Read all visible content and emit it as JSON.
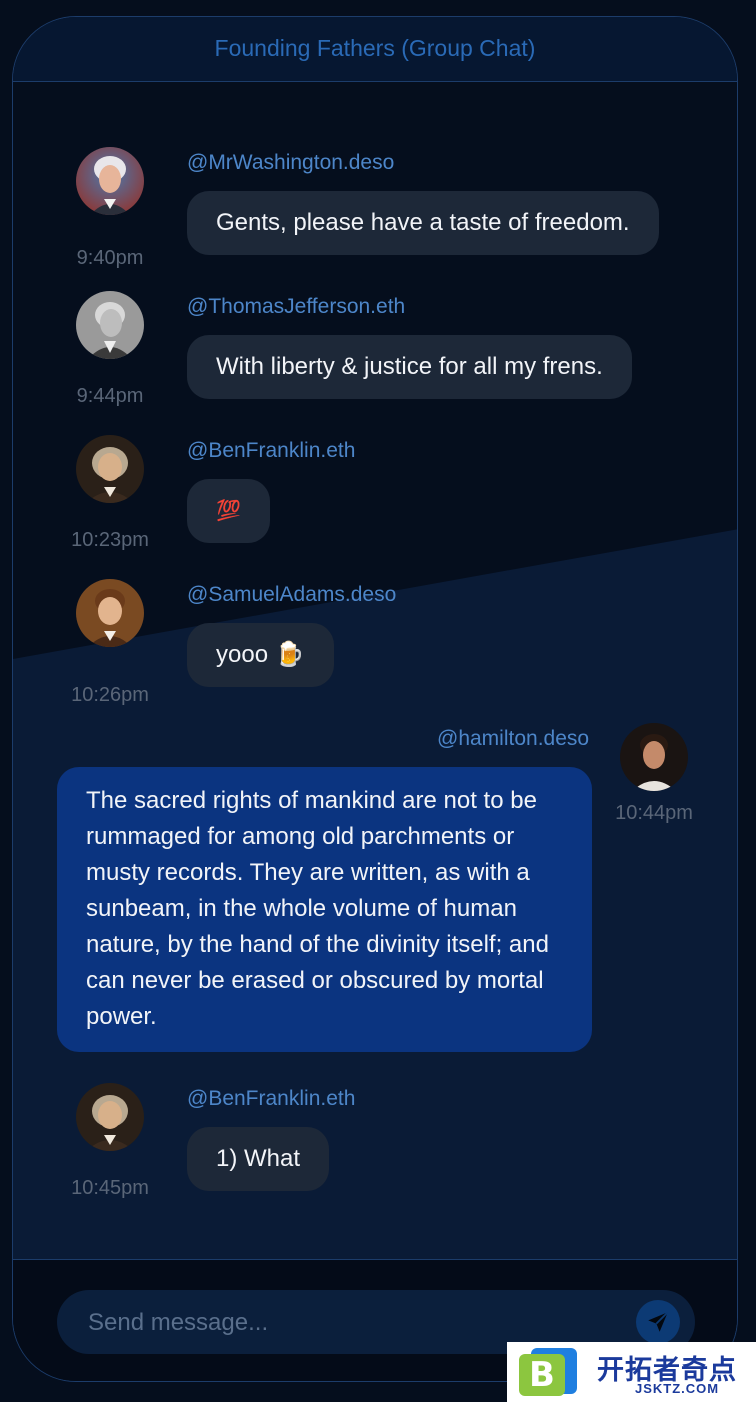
{
  "header": {
    "title": "Founding Fathers (Group Chat)"
  },
  "messages": [
    {
      "handle": "@MrWashington.deso",
      "text": "Gents, please have a taste of freedom.",
      "time": "9:40pm",
      "avatar": "washington-avatar",
      "mine": false
    },
    {
      "handle": "@ThomasJefferson.eth",
      "text": "With liberty & justice for all my frens.",
      "time": "9:44pm",
      "avatar": "jefferson-avatar",
      "mine": false
    },
    {
      "handle": "@BenFranklin.eth",
      "text": "💯",
      "time": "10:23pm",
      "avatar": "franklin-avatar",
      "mine": false
    },
    {
      "handle": "@SamuelAdams.deso",
      "text": "yooo 🍺",
      "time": "10:26pm",
      "avatar": "adams-avatar",
      "mine": false
    },
    {
      "handle": "@hamilton.deso",
      "text": "The sacred rights of mankind are not to be rummaged for among old parchments or musty records. They are written, as with a sunbeam, in the whole volume of human nature, by the hand of the divinity itself; and can never be erased or obscured by mortal power.",
      "time": "10:44pm",
      "avatar": "hamilton-avatar",
      "mine": true
    },
    {
      "handle": "@BenFranklin.eth",
      "text": "1) What",
      "time": "10:45pm",
      "avatar": "franklin-avatar",
      "mine": false
    }
  ],
  "composer": {
    "placeholder": "Send message...",
    "send_icon": "send-icon"
  },
  "watermark": {
    "cn": "开拓者奇点",
    "en": "JSKTZ.COM",
    "logo_letter": "B"
  },
  "colors": {
    "background": "#050e1d",
    "header_title": "#2a6ab6",
    "handle": "#4d86c9",
    "bubble_other": "#1d2838",
    "bubble_mine": "#0b3480",
    "border": "#1c3c6a"
  }
}
